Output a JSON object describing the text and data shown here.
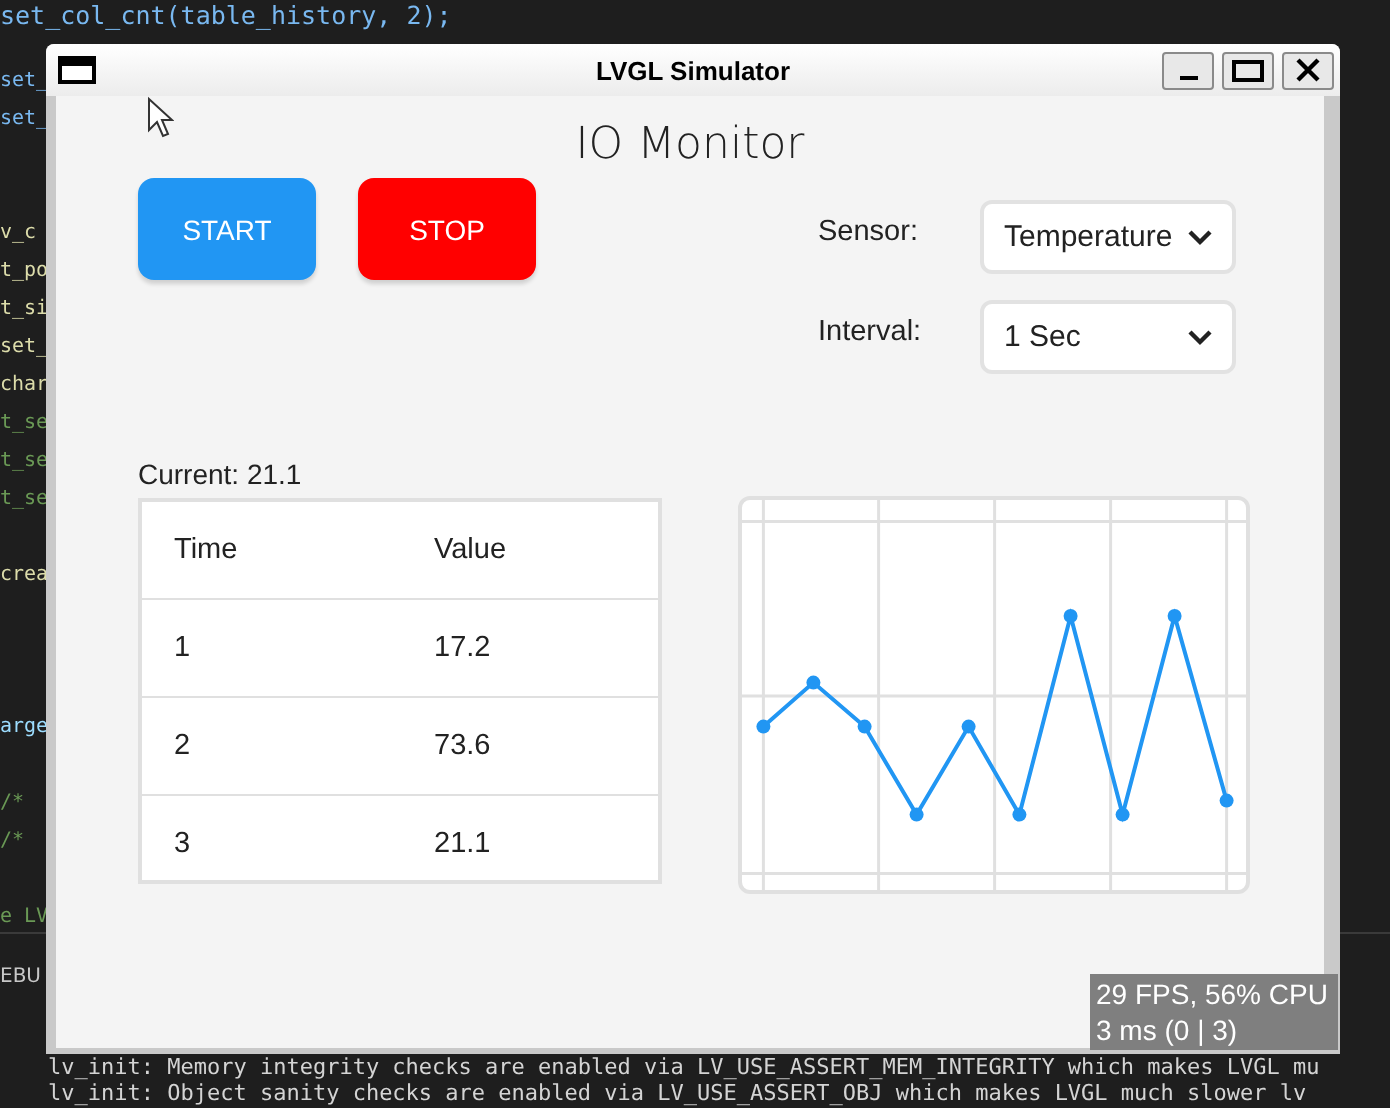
{
  "editor": {
    "lines": [
      {
        "text": "set_col_cnt(table_history, 2);",
        "kind": "call"
      },
      {
        "text": "set_",
        "kind": "call"
      },
      {
        "text": "set_",
        "kind": "call"
      },
      {
        "text": "v_c",
        "kind": "func"
      },
      {
        "text": "t_po",
        "kind": "func"
      },
      {
        "text": "t_si",
        "kind": "func"
      },
      {
        "text": "set_",
        "kind": "func"
      },
      {
        "text": "char",
        "kind": "func"
      },
      {
        "text": "t_se",
        "kind": "comment"
      },
      {
        "text": "t_se",
        "kind": "comment"
      },
      {
        "text": "t_se",
        "kind": "comment"
      },
      {
        "text": "crea",
        "kind": "func"
      },
      {
        "text": "arge",
        "kind": "variable"
      },
      {
        "text": "/*",
        "kind": "comment"
      },
      {
        "text": "/*",
        "kind": "comment"
      },
      {
        "text": "e LV",
        "kind": "comment"
      }
    ],
    "panel_tab": "EBU",
    "console": [
      "lv_init: Memory integrity checks are enabled via LV_USE_ASSERT_MEM_INTEGRITY which makes LVGL mu",
      "lv_init: Object sanity checks are enabled via LV_USE_ASSERT_OBJ which makes LVGL much slower lv"
    ]
  },
  "window": {
    "title": "LVGL Simulator"
  },
  "app": {
    "title": "IO Monitor",
    "buttons": [
      {
        "label": "START",
        "color": "#2196f3"
      },
      {
        "label": "STOP",
        "color": "#ff0000"
      }
    ],
    "settings": [
      {
        "label": "Sensor:",
        "value": "Temperature"
      },
      {
        "label": "Interval:",
        "value": "1 Sec"
      }
    ],
    "current": "Current: 21.1",
    "table": {
      "columns": [
        "Time",
        "Value"
      ],
      "rows": [
        [
          "1",
          "17.2"
        ],
        [
          "2",
          "73.6"
        ],
        [
          "3",
          "21.1"
        ]
      ]
    }
  },
  "perf_overlay": [
    "29 FPS, 56% CPU",
    "3 ms (0 | 3)"
  ]
}
